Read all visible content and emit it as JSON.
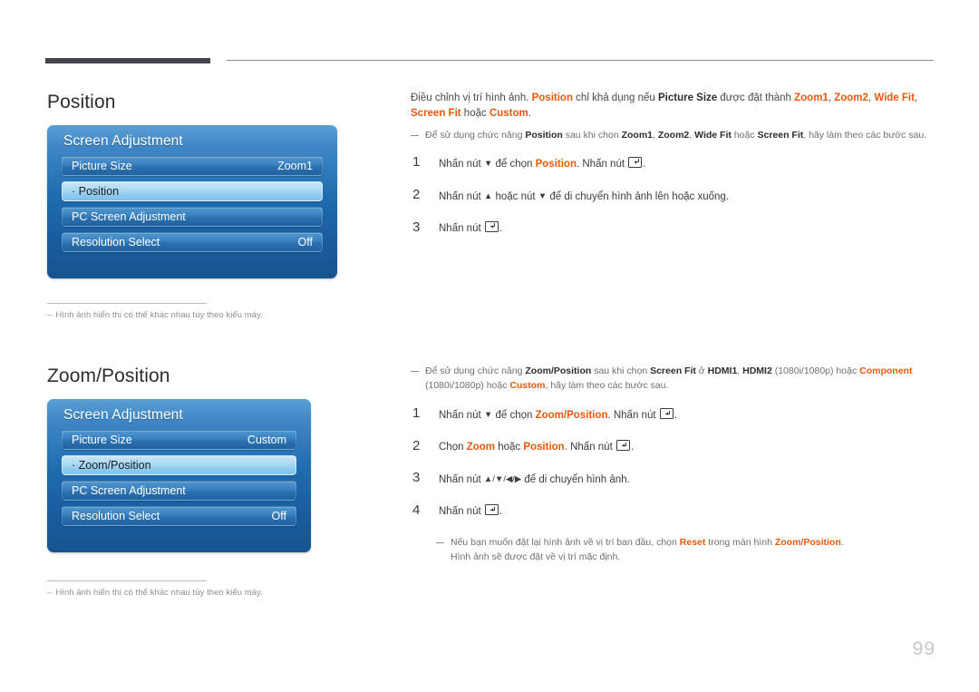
{
  "page": {
    "number": "99"
  },
  "sections": [
    {
      "heading": "Position",
      "panel": {
        "title": "Screen Adjustment",
        "rows": [
          {
            "label": "Picture Size",
            "value": "Zoom1",
            "selected": false
          },
          {
            "label": "· Position",
            "value": "",
            "selected": true
          },
          {
            "label": "PC Screen Adjustment",
            "value": "",
            "selected": false
          },
          {
            "label": "Resolution Select",
            "value": "Off",
            "selected": false
          }
        ]
      },
      "footnote": {
        "dash": "–",
        "text": "Hình ảnh hiển thị có thể khác nhau tùy theo kiểu máy."
      },
      "intro": {
        "text_1": "Điều chỉnh vị trí hình ảnh. ",
        "term_1": "Position",
        "text_2": " chỉ khả dụng nếu ",
        "term_2": "Picture Size",
        "text_3": " được đặt thành ",
        "term_3": "Zoom1",
        "text_4": ", ",
        "term_4": "Zoom2",
        "text_5": ", ",
        "term_5": "Wide Fit",
        "text_6": ", ",
        "term_6": "Screen Fit",
        "text_7": " hoặc ",
        "term_7": "Custom",
        "text_8": "."
      },
      "note": {
        "text_1": "Để sử dụng chức năng ",
        "term_1": "Position",
        "text_2": " sau khi chọn ",
        "term_2": "Zoom1",
        "text_3": ", ",
        "term_3": "Zoom2",
        "text_4": ", ",
        "term_4": "Wide Fit",
        "text_5": " hoặc ",
        "term_5": "Screen Fit",
        "text_6": ", hãy làm theo các bước sau."
      },
      "steps": [
        {
          "num": "1",
          "text_1": "Nhấn nút ",
          "arrow_1": "▼",
          "text_2": " để chọn ",
          "term_1": "Position",
          "text_3": ". Nhấn nút ",
          "key": "enter-key",
          "text_4": "."
        },
        {
          "num": "2",
          "text_1": "Nhấn nút ",
          "arrow_1": "▲",
          "text_2": " hoặc nút ",
          "arrow_2": "▼",
          "text_3": " để di chuyển hình ảnh lên hoặc xuống.",
          "term_1": "",
          "text_4": ""
        },
        {
          "num": "3",
          "text_1": "Nhấn nút ",
          "key": "enter-key",
          "text_2": "."
        }
      ]
    },
    {
      "heading": "Zoom/Position",
      "panel": {
        "title": "Screen Adjustment",
        "rows": [
          {
            "label": "Picture Size",
            "value": "Custom",
            "selected": false
          },
          {
            "label": "· Zoom/Position",
            "value": "",
            "selected": true
          },
          {
            "label": "PC Screen Adjustment",
            "value": "",
            "selected": false
          },
          {
            "label": "Resolution Select",
            "value": "Off",
            "selected": false
          }
        ]
      },
      "footnote": {
        "dash": "–",
        "text": "Hình ảnh hiển thị có thể khác nhau tùy theo kiểu máy."
      },
      "note": {
        "text_1": "Để sử dụng chức năng ",
        "term_1": "Zoom/Position",
        "text_2": " sau khi chọn ",
        "term_2": "Screen Fit",
        "text_3": " ở ",
        "term_3": "HDMI1",
        "text_4": ", ",
        "term_4": "HDMI2",
        "text_5": " (1080i/1080p) hoặc ",
        "term_5": "Component",
        "text_6": " (1080i/1080p) hoặc ",
        "term_6": "Custom",
        "text_7": ", hãy làm theo các bước sau."
      },
      "steps": [
        {
          "num": "1",
          "text_1": "Nhấn nút ",
          "arrow_1": "▼",
          "text_2": " để chọn ",
          "term_1": "Zoom/Position",
          "text_3": ". Nhấn nút ",
          "key": "enter-key",
          "text_4": "."
        },
        {
          "num": "2",
          "text_1": "Chọn ",
          "term_1": "Zoom",
          "text_2": " hoặc ",
          "term_2": "Position",
          "text_3": ". Nhấn nút ",
          "key": "enter-key",
          "text_4": "."
        },
        {
          "num": "3",
          "text_1": "Nhấn nút ",
          "arrow_1": "▲/▼/◀/▶",
          "text_2": " để di chuyển hình ảnh."
        },
        {
          "num": "4",
          "text_1": "Nhấn nút ",
          "key": "enter-key",
          "text_2": "."
        }
      ],
      "reset_note": {
        "text_1": "Nếu bạn muốn đặt lại hình ảnh về vị trí ban đầu, chọn ",
        "term_1": "Reset",
        "text_2": " trong màn hình ",
        "term_2": "Zoom/Position",
        "text_3": ".",
        "line_2": "Hình ảnh sẽ được đặt về vị trí mặc định."
      }
    }
  ],
  "colors": {
    "accent_orange": "#e8590c",
    "panel_blue_top": "#5b9fd4",
    "panel_blue_bottom": "#17538f",
    "selected_row": "#a8d8f2",
    "header_bar": "#44444f",
    "page_number": "#c6c6d0"
  }
}
